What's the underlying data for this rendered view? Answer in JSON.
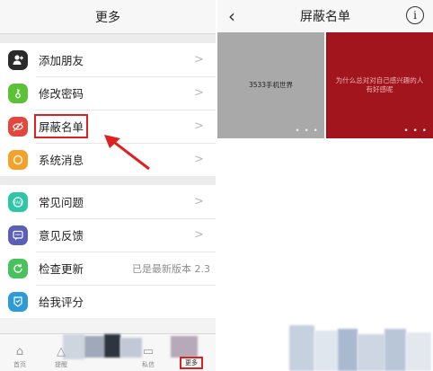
{
  "left": {
    "title": "更多",
    "group1": [
      {
        "label": "添加朋友",
        "icon": "add-friend-icon",
        "color": "#2a2a2a"
      },
      {
        "label": "修改密码",
        "icon": "key-icon",
        "color": "#5bc236"
      },
      {
        "label": "屏蔽名单",
        "icon": "eye-off-icon",
        "color": "#e2463d"
      },
      {
        "label": "系统消息",
        "icon": "message-icon",
        "color": "#f4a12a"
      }
    ],
    "group2": [
      {
        "label": "常见问题",
        "icon": "faq-icon",
        "color": "#2fc6a8"
      },
      {
        "label": "意见反馈",
        "icon": "feedback-icon",
        "color": "#5a5fb7"
      },
      {
        "label": "检查更新",
        "icon": "refresh-icon",
        "color": "#48c25c",
        "value": "已是最新版本 2.3"
      },
      {
        "label": "给我评分",
        "icon": "rate-icon",
        "color": "#2e9bd6"
      }
    ],
    "tabs": [
      {
        "label": "首页",
        "icon": "home-icon"
      },
      {
        "label": "提醒",
        "icon": "bell-icon"
      },
      {
        "label": "私信",
        "icon": "mail-icon"
      },
      {
        "label": "更多",
        "icon": "more-icon"
      }
    ]
  },
  "right": {
    "title": "屏蔽名单",
    "tiles": [
      {
        "text": "3533手机世界",
        "dots": "• • •"
      },
      {
        "text": "为什么总对对自己感兴趣的人有好感呢",
        "dots": "• • •"
      }
    ]
  },
  "colors": {
    "highlight": "#e02020",
    "red_tile": "#a3151c",
    "gray_tile": "#a9a9a9"
  }
}
